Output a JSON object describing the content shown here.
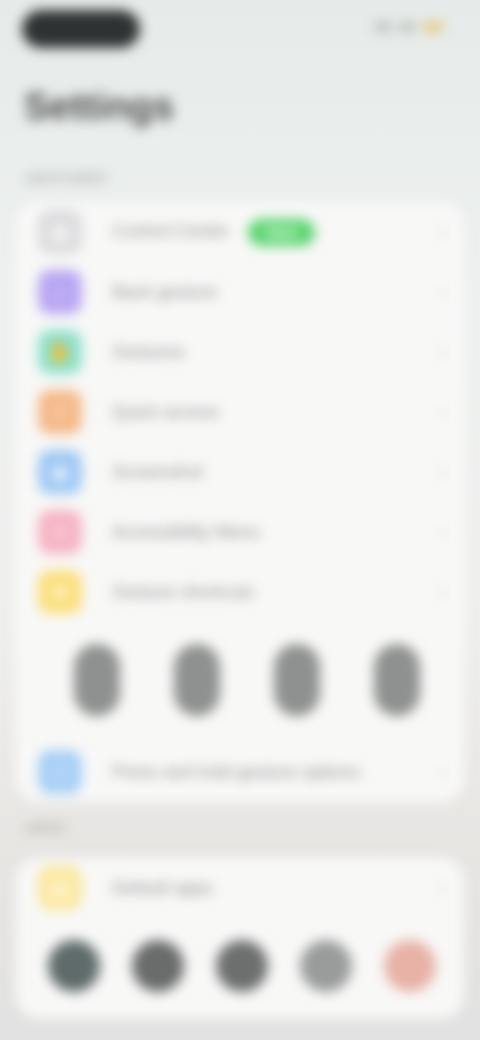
{
  "status_bar": {
    "time_pill_icon": "status-time-pill",
    "right_icons": [
      "signal-icon",
      "wifi-icon",
      "battery-icon"
    ]
  },
  "header": {
    "title": "Settings"
  },
  "sections": [
    {
      "header": "Gestures",
      "items": [
        {
          "label": "Control Center",
          "badge": "New",
          "icon": "toggles-icon",
          "color": "#dcdcde"
        },
        {
          "label": "Back gesture",
          "icon": "arrow-left-icon",
          "color": "#b9a6f3"
        },
        {
          "label": "Gestures",
          "icon": "hand-icon",
          "color": "#8fe0cb"
        },
        {
          "label": "Quick access",
          "icon": "bolt-icon",
          "color": "#f5b98a"
        },
        {
          "label": "Screenshot",
          "icon": "camera-icon",
          "color": "#9fc8f5"
        },
        {
          "label": "Accessibility Menu",
          "icon": "accessibility-icon",
          "color": "#f6b4c4"
        },
        {
          "label": "Gesture shortcuts",
          "icon": "star-icon",
          "color": "#fbe07f"
        }
      ],
      "gesture_previews": [
        "gesture-preview-1",
        "gesture-preview-2",
        "gesture-preview-3",
        "gesture-preview-4"
      ],
      "footer_item": {
        "label": "Press and hold gesture options",
        "icon": "finger-icon",
        "color": "#a9d0f7"
      }
    },
    {
      "header": "Apps",
      "items": [
        {
          "label": "Default apps",
          "icon": "grid-icon",
          "color": "#fbe8a0"
        }
      ],
      "app_icons": [
        {
          "name": "app-icon-1",
          "color": "#5f6b6b"
        },
        {
          "name": "app-icon-2",
          "color": "#6a6c6c"
        },
        {
          "name": "app-icon-3",
          "color": "#6d6f6f"
        },
        {
          "name": "app-icon-4",
          "color": "#9a9c9c"
        },
        {
          "name": "app-icon-5",
          "color": "#e8b2a6"
        }
      ]
    }
  ]
}
